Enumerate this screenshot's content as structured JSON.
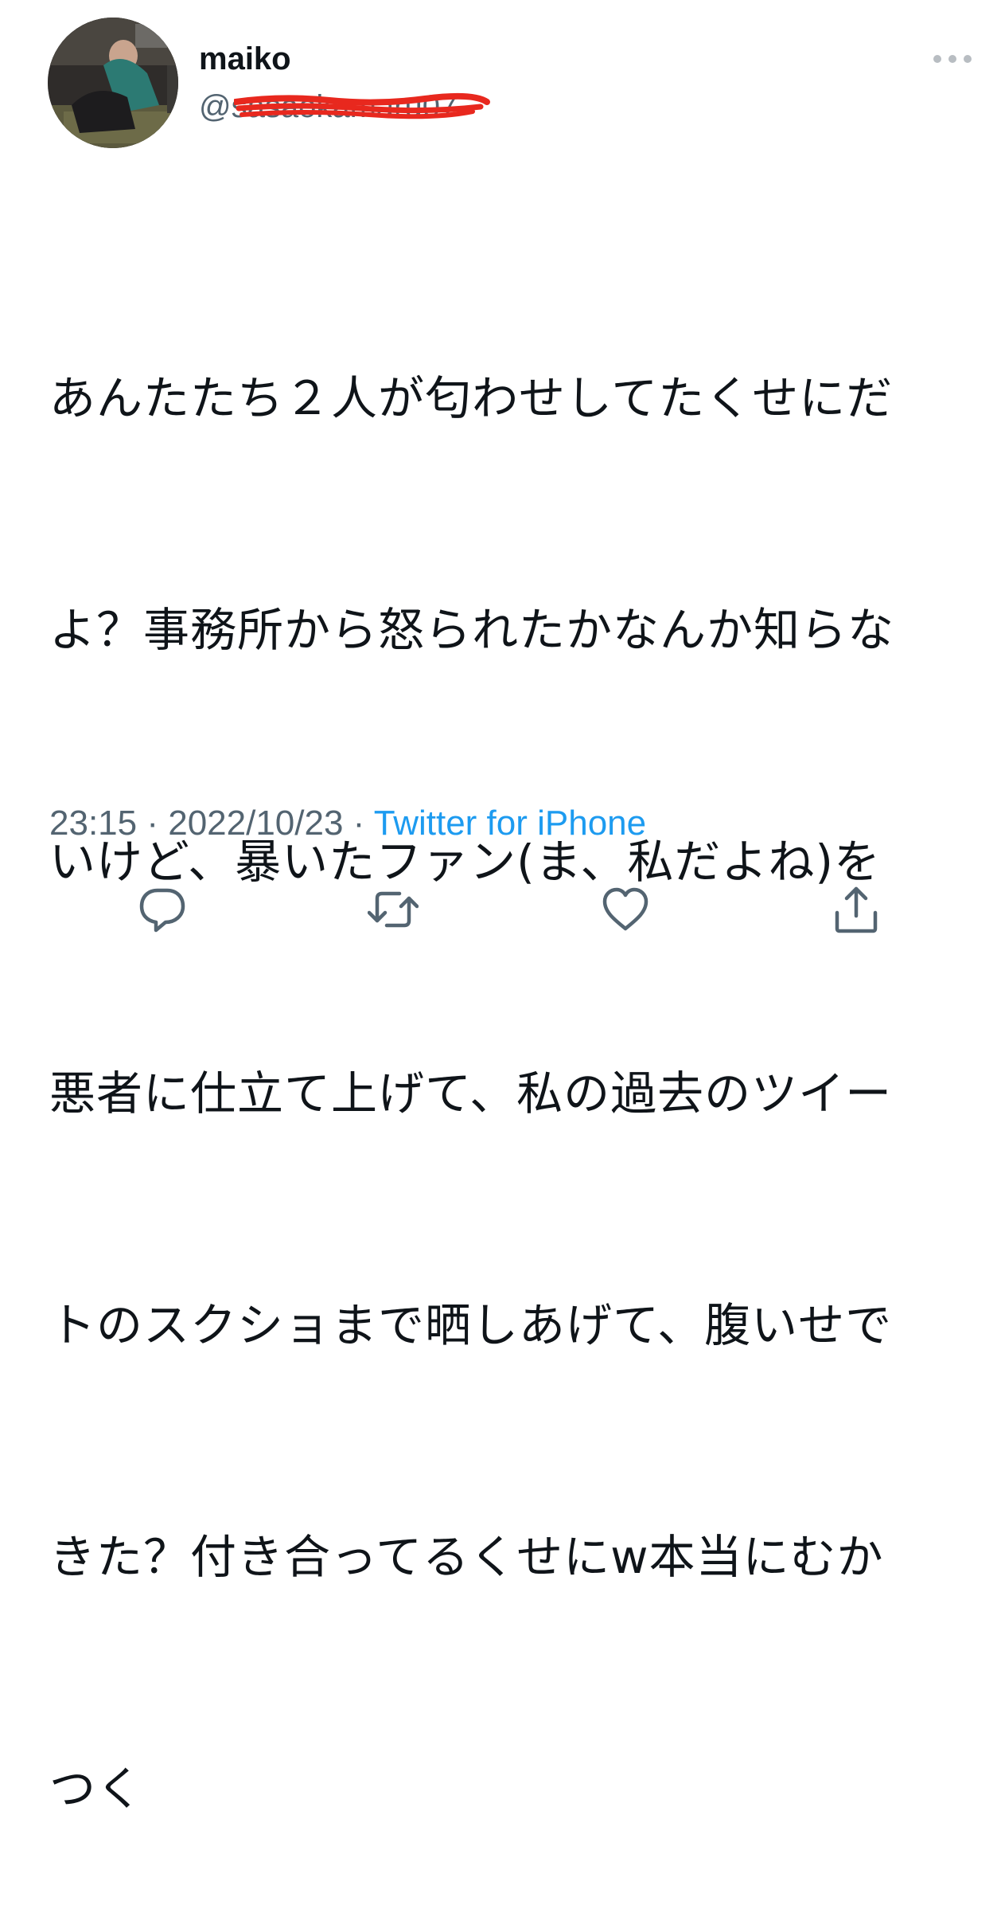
{
  "user": {
    "display_name": "maiko",
    "handle": "@sasaokamaru07",
    "avatar_icon": "profile-photo",
    "more_icon": "more-horizontal-icon"
  },
  "tweet": {
    "lines": [
      "あんたたち２人が匂わせしてたくせにだ",
      "よ？事務所から怒られたかなんか知らな",
      "いけど、暴いたファン(ま、私だよね)を",
      "悪者に仕立て上げて、私の過去のツイー",
      "トのスクショまで晒しあげて、腹いせで",
      "きた？付き合ってるくせにw本当にむか",
      "つく"
    ],
    "time": "23:15",
    "date": "2022/10/23",
    "separator": " · ",
    "source": "Twitter for iPhone"
  },
  "actions": [
    {
      "name": "reply",
      "icon": "reply-icon"
    },
    {
      "name": "retweet",
      "icon": "retweet-icon"
    },
    {
      "name": "like",
      "icon": "heart-icon"
    },
    {
      "name": "share",
      "icon": "share-icon"
    }
  ],
  "colors": {
    "text": "#0f1419",
    "secondary": "#536471",
    "link": "#1d9bf0",
    "redaction": "#e8281e"
  }
}
